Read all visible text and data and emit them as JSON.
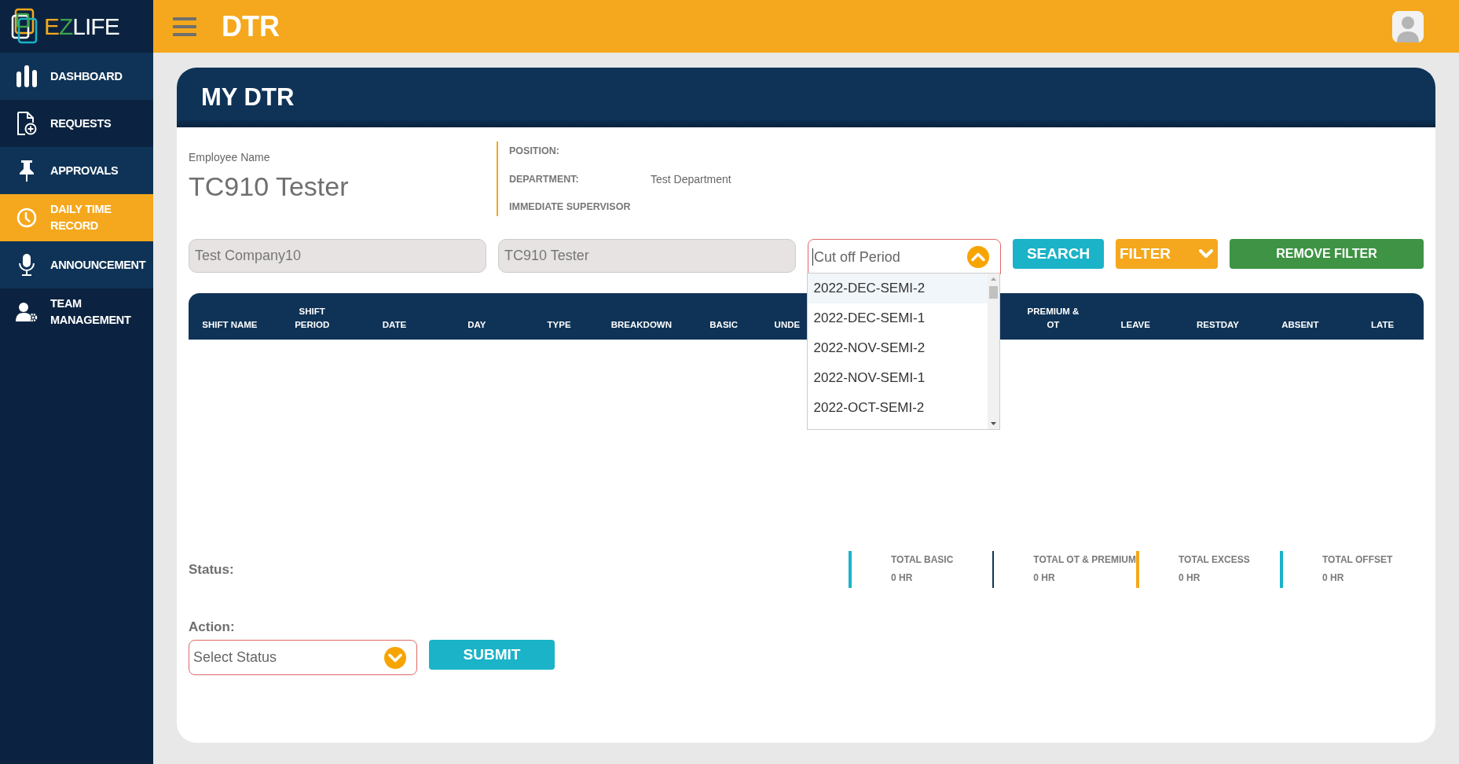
{
  "logo": {
    "parts": [
      {
        "text": "E",
        "color": "#f5a81d"
      },
      {
        "text": "Z",
        "color": "#3fa34d"
      },
      {
        "text": "LIFE",
        "color": "#ffffff"
      }
    ]
  },
  "sidebar": {
    "items": [
      {
        "label": "DASHBOARD",
        "selected": false
      },
      {
        "label": "REQUESTS",
        "selected": false
      },
      {
        "label": "APPROVALS",
        "selected": false
      },
      {
        "label": "DAILY TIME RECORD",
        "selected": true
      },
      {
        "label": "ANNOUNCEMENT",
        "selected": false
      },
      {
        "label": "TEAM MANAGEMENT",
        "selected": false
      }
    ]
  },
  "topbar": {
    "title": "DTR"
  },
  "card": {
    "title": "MY DTR"
  },
  "employee": {
    "label": "Employee Name",
    "name": "TC910 Tester",
    "details": [
      {
        "label": "POSITION:"
      },
      {
        "label": "DEPARTMENT:",
        "value": "Test Department"
      },
      {
        "label": "IMMEDIATE SUPERVISOR"
      }
    ]
  },
  "filters": {
    "company": {
      "value": "Test Company10",
      "disabled": true
    },
    "employee": {
      "value": "TC910 Tester",
      "disabled": true
    },
    "cutoff": {
      "placeholder": "Cut off Period",
      "expanded": true,
      "options": [
        {
          "label": "2022-DEC-SEMI-2",
          "selected": true
        },
        {
          "label": "2022-DEC-SEMI-1",
          "selected": false
        },
        {
          "label": "2022-NOV-SEMI-2",
          "selected": false
        },
        {
          "label": "2022-NOV-SEMI-1",
          "selected": false
        },
        {
          "label": "2022-OCT-SEMI-2",
          "selected": false
        }
      ]
    },
    "buttons": [
      {
        "label": "SEARCH",
        "kind": "search"
      },
      {
        "label": "FILTER",
        "kind": "dropdown"
      },
      {
        "label": "REMOVE FILTER",
        "kind": "remove"
      }
    ]
  },
  "table": {
    "columns": [
      "SHIFT NAME",
      "SHIFT\nPERIOD",
      "DATE",
      "DAY",
      "TYPE",
      "BREAKDOWN",
      "BASIC",
      "UNDE",
      "PREMIUM &\nOT",
      "LEAVE",
      "RESTDAY",
      "ABSENT",
      "LATE"
    ]
  },
  "status": {
    "label": "Status:",
    "totals": [
      {
        "label": "TOTAL BASIC",
        "value": "0 HR",
        "color": "#1ab3c8"
      },
      {
        "label": "TOTAL OT & PREMIUM",
        "value": "0 HR",
        "color": "#0f3356"
      },
      {
        "label": "TOTAL EXCESS",
        "value": "0 HR",
        "color": "#f5a81d"
      },
      {
        "label": "TOTAL OFFSET",
        "value": "0 HR",
        "color": "#1ab3c8"
      }
    ]
  },
  "action": {
    "label": "Action:",
    "select": {
      "placeholder": "Select Status",
      "expanded": false
    },
    "button": "SUBMIT"
  }
}
